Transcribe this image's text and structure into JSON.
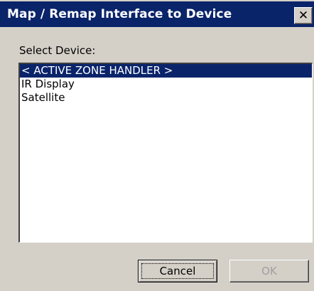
{
  "window": {
    "title": "Map / Remap Interface to Device",
    "close_glyph": "✕"
  },
  "form": {
    "select_label": "Select Device:"
  },
  "devices": [
    {
      "label": "< ACTIVE ZONE HANDLER >",
      "selected": true
    },
    {
      "label": "IR Display",
      "selected": false
    },
    {
      "label": "Satellite",
      "selected": false
    }
  ],
  "buttons": {
    "cancel_label": "Cancel",
    "ok_label": "OK",
    "ok_enabled": false
  },
  "colors": {
    "titlebar": "#0a246a",
    "selection": "#0a246a",
    "face": "#d4d0c8"
  }
}
